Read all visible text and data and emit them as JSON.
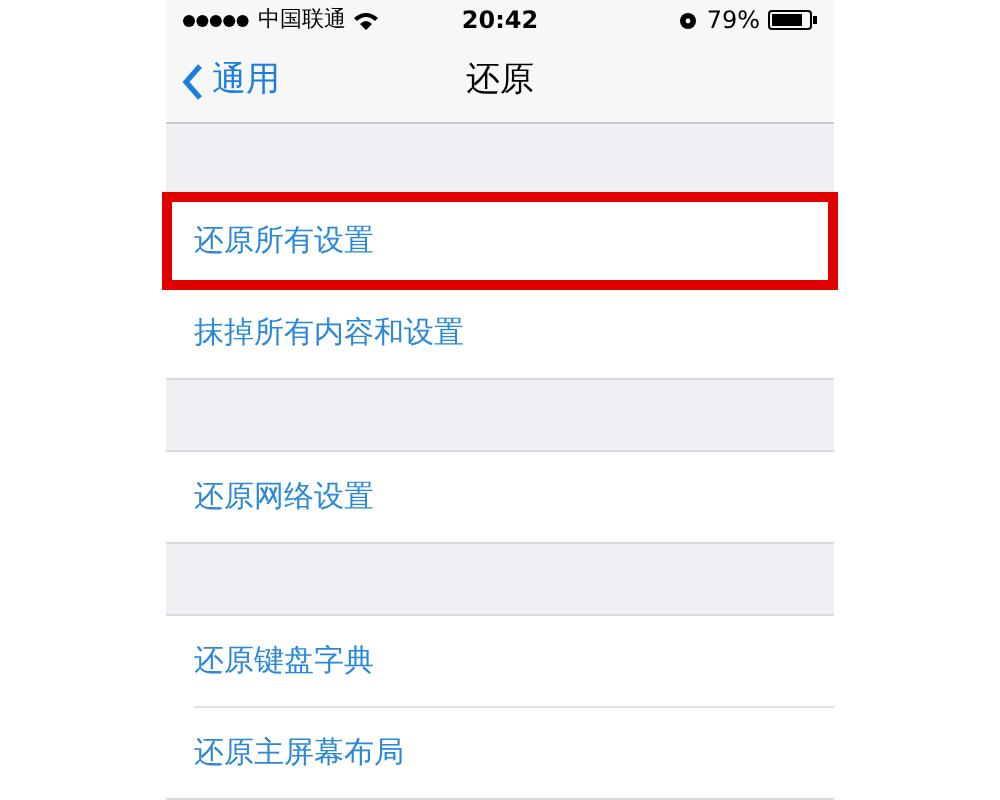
{
  "status_bar": {
    "carrier": "中国联通",
    "time": "20:42",
    "battery": "79%"
  },
  "nav_bar": {
    "back": "通用",
    "title": "还原"
  },
  "groups": [
    {
      "rows": [
        {
          "label": "还原所有设置",
          "highlighted": true
        },
        {
          "label": "抹掉所有内容和设置",
          "highlighted": false
        }
      ]
    },
    {
      "rows": [
        {
          "label": "还原网络设置",
          "highlighted": false
        }
      ]
    },
    {
      "rows": [
        {
          "label": "还原键盘字典",
          "highlighted": false
        },
        {
          "label": "还原主屏幕布局",
          "highlighted": false
        }
      ]
    }
  ]
}
